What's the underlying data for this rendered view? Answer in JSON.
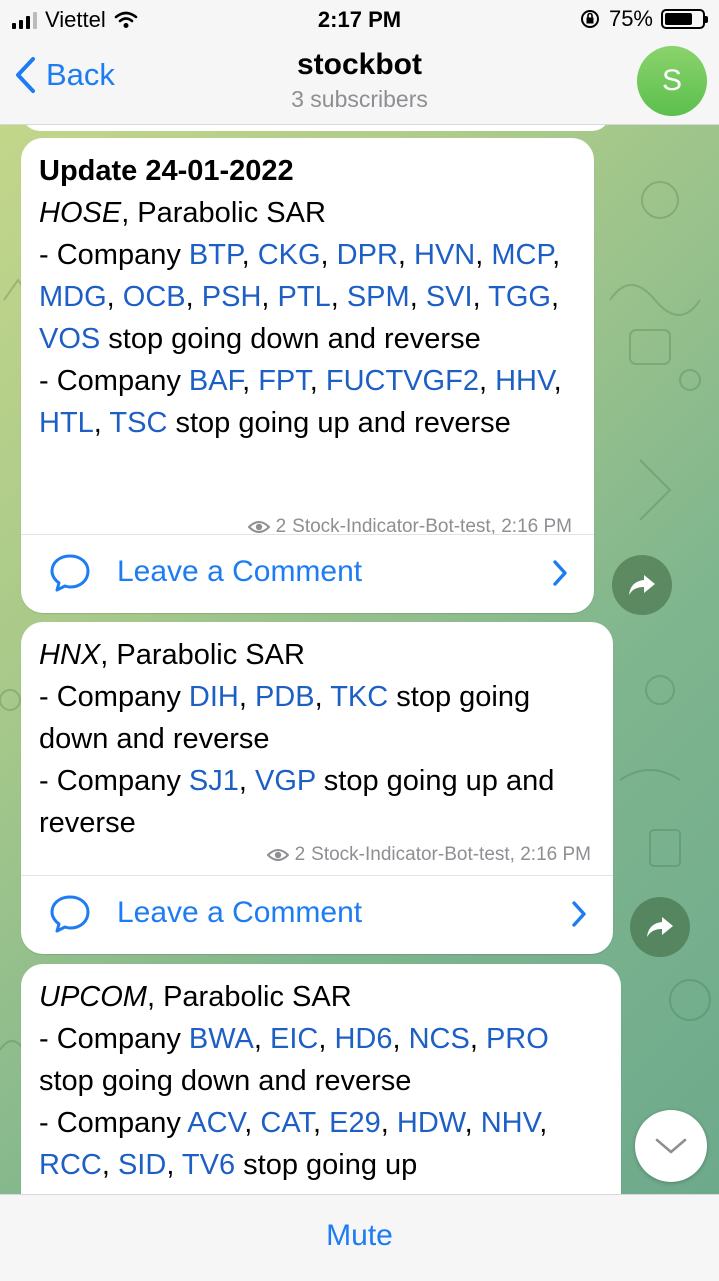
{
  "status": {
    "carrier": "Viettel",
    "time": "2:17 PM",
    "battery": "75%",
    "battery_level": 0.75
  },
  "nav": {
    "back_label": "Back",
    "title": "stockbot",
    "subtitle": "3 subscribers",
    "avatar_letter": "S"
  },
  "messages": [
    {
      "title": "Update 24-01-2022",
      "exchange": "HOSE",
      "indicator": ", Parabolic SAR",
      "line1_prefix": "- Company ",
      "line1_companies": [
        "BTP",
        "CKG",
        "DPR",
        "HVN",
        "MCP",
        "MDG",
        "OCB",
        "PSH",
        "PTL",
        "SPM",
        "SVI",
        "TGG",
        "VOS"
      ],
      "line1_suffix": " stop going down and reverse",
      "line2_prefix": "- Company ",
      "line2_companies": [
        "BAF",
        "FPT",
        "FUCTVGF2",
        "HHV",
        "HTL",
        "TSC"
      ],
      "line2_suffix": " stop going up and reverse",
      "views": "2",
      "author": "Stock-Indicator-Bot-test, 2:16 PM",
      "comment_label": "Leave a Comment"
    },
    {
      "exchange": "HNX",
      "indicator": ", Parabolic SAR",
      "line1_prefix": "- Company ",
      "line1_companies": [
        "DIH",
        "PDB",
        "TKC"
      ],
      "line1_suffix": " stop going down and reverse",
      "line2_prefix": "- Company ",
      "line2_companies": [
        "SJ1",
        "VGP"
      ],
      "line2_suffix": " stop going up and reverse",
      "views": "2",
      "author": "Stock-Indicator-Bot-test, 2:16 PM",
      "comment_label": "Leave a Comment"
    },
    {
      "exchange": "UPCOM",
      "indicator": ", Parabolic SAR",
      "line1_prefix": "- Company ",
      "line1_companies": [
        "BWA",
        "EIC",
        "HD6",
        "NCS",
        "PRO"
      ],
      "line1_suffix": " stop going down and reverse",
      "line2_prefix": "- Company ",
      "line2_companies": [
        "ACV",
        "CAT",
        "E29",
        "HDW",
        "NHV",
        "RCC",
        "SID",
        "TV6"
      ],
      "line2_suffix": " stop going up"
    }
  ],
  "bottom": {
    "mute_label": "Mute"
  },
  "colors": {
    "link": "#1d5fc4",
    "accent": "#1e7cf2",
    "meta": "#8e8e93"
  }
}
